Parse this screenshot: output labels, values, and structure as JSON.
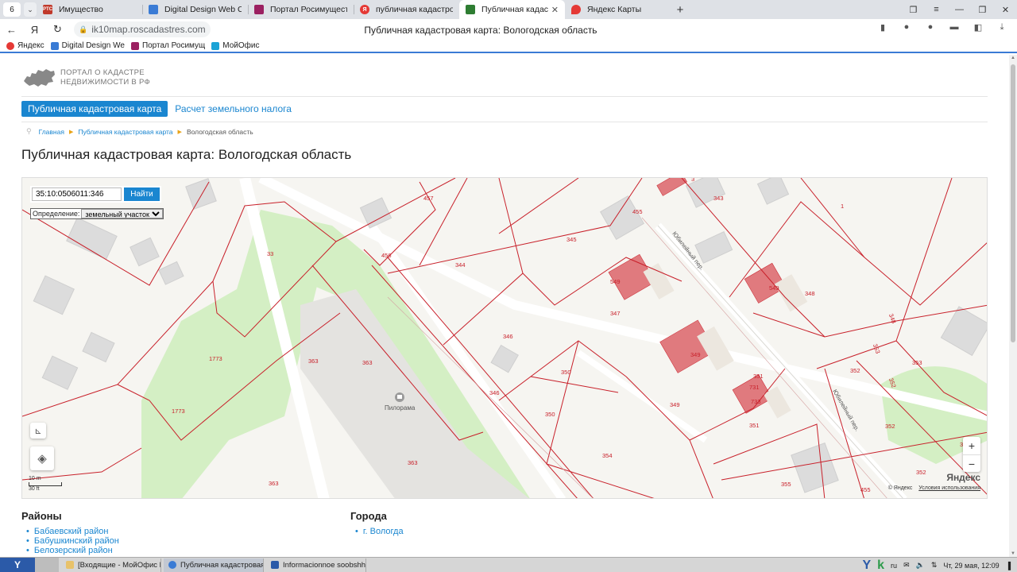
{
  "browser": {
    "tab_count": "6",
    "tabs": [
      {
        "title": "Имущество",
        "icon": "ps-icon",
        "color": "#c0392b",
        "glyph": "РТС"
      },
      {
        "title": "Digital Design Web Client",
        "icon": "dd-icon",
        "color": "#3a7bd5",
        "glyph": ""
      },
      {
        "title": "Портал Росимущества",
        "icon": "rosim-icon",
        "color": "#9b2061",
        "glyph": ""
      },
      {
        "title": "публичная кадастровая",
        "icon": "yandex-search-icon",
        "color": "#e53935",
        "glyph": "Я"
      },
      {
        "title": "Публичная кадастрова",
        "icon": "map-icon",
        "color": "#2e7d32",
        "glyph": ""
      },
      {
        "title": "Яндекс Карты",
        "icon": "yandex-maps-icon",
        "color": "#e53935",
        "glyph": ""
      }
    ],
    "url": "ik10map.roscadastres.com",
    "page_title": "Публичная кадастровая карта: Вологодская область",
    "bookmarks": [
      {
        "label": "Яндекс",
        "color": "#e53935"
      },
      {
        "label": "Digital Design We",
        "color": "#3a7bd5"
      },
      {
        "label": "Портал Росимущ",
        "color": "#9b2061"
      },
      {
        "label": "МойОфис",
        "color": "#1ba3d6"
      }
    ]
  },
  "site": {
    "logo_line1": "ПОРТАЛ О КАДАСТРЕ",
    "logo_line2": "НЕДВИЖИМОСТИ В РФ",
    "menu_active": "Публичная кадастровая карта",
    "menu_link": "Расчет земельного налога",
    "breadcrumbs": [
      "Главная",
      "Публичная кадастровая карта",
      "Вологодская область"
    ],
    "heading": "Публичная кадастровая карта: Вологодская область"
  },
  "map": {
    "search_value": "35:10:0506011:346",
    "search_button": "Найти",
    "definition_label": "Определение:",
    "definition_value": "земельный участок",
    "scale_m": "10 m",
    "scale_ft": "30 ft",
    "brand": "Яндекс",
    "copyright": "© Яндекс",
    "terms": "Условия использования",
    "zoom_in": "+",
    "zoom_out": "−",
    "poi_label": "Пилорама",
    "street_label": "Юбилейный пер.",
    "accent_red": "#c8202a",
    "park_green": "#d4efc4"
  },
  "regions": {
    "title": "Районы",
    "items": [
      "Бабаевский район",
      "Бабушкинский район",
      "Белозерский район"
    ]
  },
  "cities": {
    "title": "Города",
    "items": [
      "г. Вологда"
    ]
  },
  "taskbar": {
    "items": [
      "[Входящие - МойОфис П...",
      "Публичная кадастровая ...",
      "Informacionnoe soobshhe..."
    ],
    "lang": "ru",
    "clock": "Чт, 29 мая, 12:09"
  }
}
